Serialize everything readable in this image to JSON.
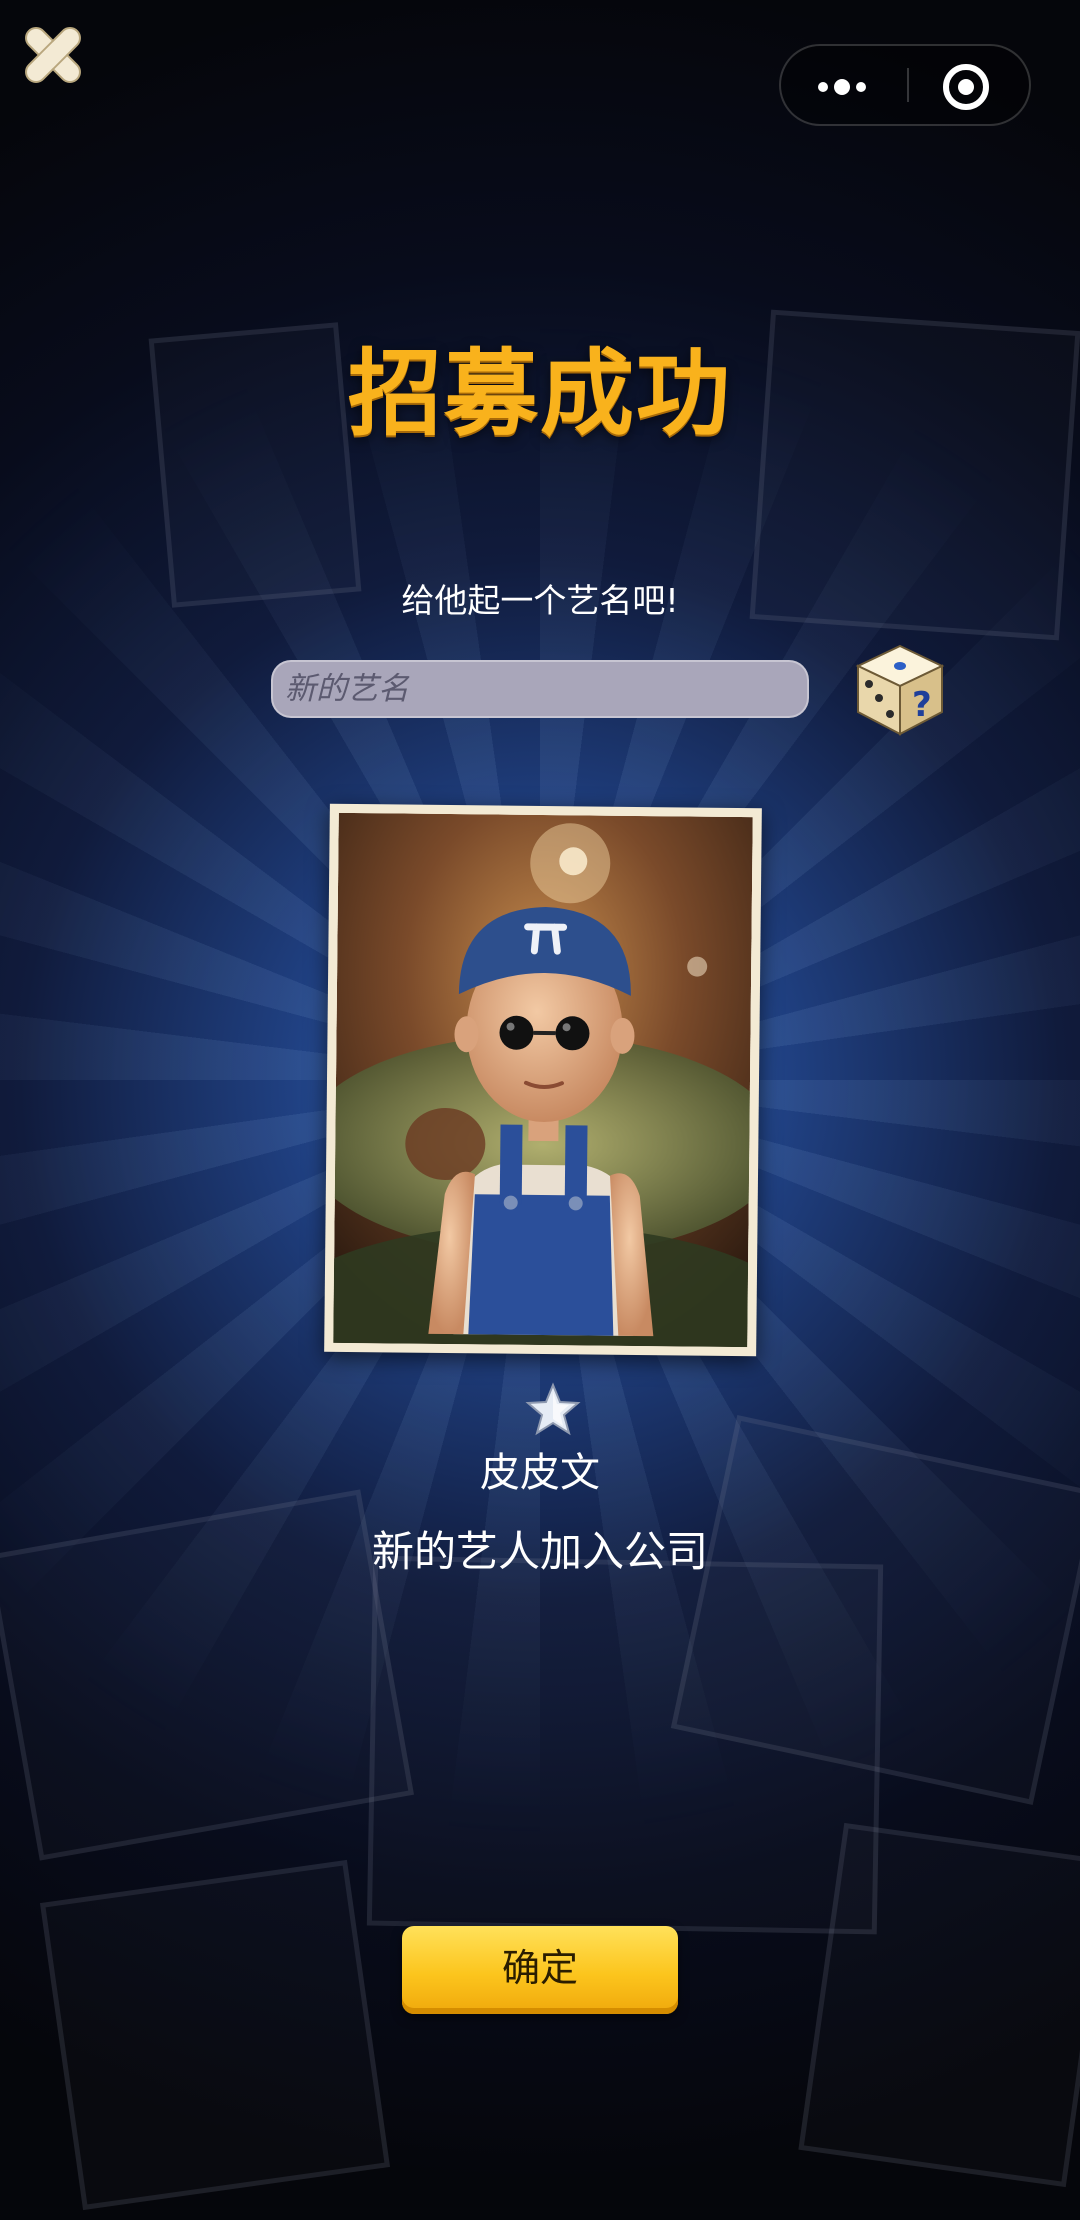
{
  "topbar": {
    "close_icon": "close-x-icon",
    "more_icon": "more-dots-icon",
    "exit_icon": "target-circle-icon"
  },
  "recruit": {
    "title": "招募成功",
    "prompt": "给他起一个艺名吧!",
    "name_input": {
      "value": "",
      "placeholder": "新的艺名"
    },
    "random_icon": "dice-question-icon",
    "card_icon": "character-portrait-icon",
    "star_icon": "star-icon",
    "star_count": 1,
    "artist_name": "皮皮文",
    "join_text": "新的艺人加入公司",
    "confirm_label": "确定"
  },
  "colors": {
    "title": "#f9b21c",
    "button": "#fcc51d",
    "background_glow": "#3f78d2"
  }
}
